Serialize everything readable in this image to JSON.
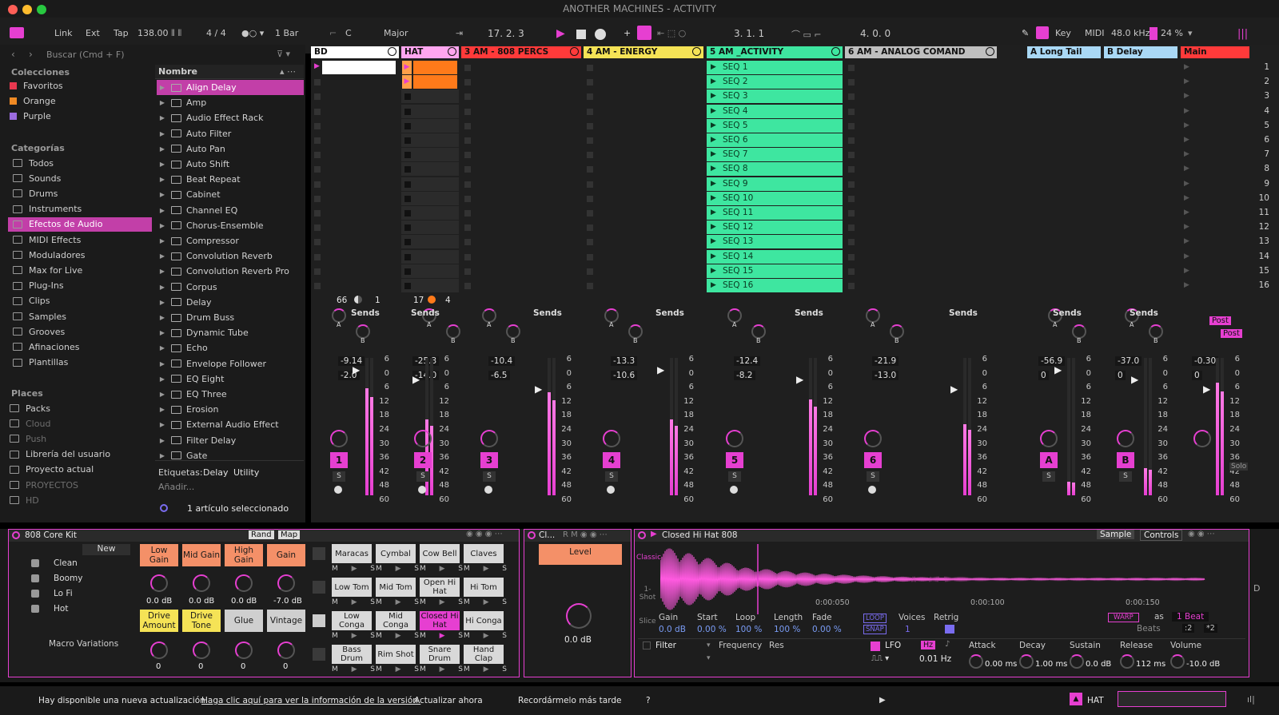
{
  "window": {
    "title": "ANOTHER MACHINES - ACTIVITY"
  },
  "control_bar": {
    "link": "Link",
    "ext": "Ext",
    "tap": "Tap",
    "tempo": "138.00",
    "signature": "4 / 4",
    "quantize": "1 Bar",
    "key_root": "C",
    "key_scale": "Major",
    "position": "17.   2.   3",
    "loop_start": "3.   1.   1",
    "loop_length": "4.   0.   0",
    "key_label": "Key",
    "midi_label": "MIDI",
    "sample_rate": "48.0 kHz",
    "cpu": "24 %"
  },
  "browser": {
    "search_placeholder": "Buscar (Cmd + F)",
    "name_header": "Nombre",
    "collections_title": "Colecciones",
    "collections": [
      {
        "label": "Favoritos",
        "color": "#e8384f"
      },
      {
        "label": "Orange",
        "color": "#f08a24"
      },
      {
        "label": "Purple",
        "color": "#9b6bdf"
      }
    ],
    "categories_title": "Categorías",
    "categories": [
      "Todos",
      "Sounds",
      "Drums",
      "Instruments",
      "Efectos de Audio",
      "MIDI Effects",
      "Moduladores",
      "Max for Live",
      "Plug-Ins",
      "Clips",
      "Samples",
      "Grooves",
      "Afinaciones",
      "Plantillas"
    ],
    "places_title": "Places",
    "places": [
      "Packs",
      "Cloud",
      "Push",
      "Librería del usuario",
      "Proyecto actual",
      "PROYECTOS",
      "HD"
    ],
    "items": [
      "Align Delay",
      "Amp",
      "Audio Effect Rack",
      "Auto Filter",
      "Auto Pan",
      "Auto Shift",
      "Beat Repeat",
      "Cabinet",
      "Channel EQ",
      "Chorus-Ensemble",
      "Compressor",
      "Convolution Reverb",
      "Convolution Reverb Pro",
      "Corpus",
      "Delay",
      "Drum Buss",
      "Dynamic Tube",
      "Echo",
      "Envelope Follower",
      "EQ Eight",
      "EQ Three",
      "Erosion",
      "External Audio Effect",
      "Filter Delay",
      "Gate"
    ],
    "tags_label": "Etiquetas:",
    "tags": [
      "Delay",
      "Utility"
    ],
    "add_label": "Añadir...",
    "selection_status": "1 artículo seleccionado"
  },
  "tracks": [
    {
      "name": "BD",
      "color": "#ffffff",
      "vol": "-9.14",
      "pan": "-2.0",
      "num": "1",
      "meter": 0.78
    },
    {
      "name": "HAT",
      "color": "#ffa6f0",
      "vol": "-25.3",
      "pan": "-14.0",
      "num": "2",
      "meter": 0.55
    },
    {
      "name": "3 AM - 808 PERCS",
      "color": "#ff3a3a",
      "vol": "-10.4",
      "pan": "-6.5",
      "num": "3",
      "meter": 0.75
    },
    {
      "name": "4 AM - ENERGY",
      "color": "#f5e356",
      "vol": "-13.3",
      "pan": "-10.6",
      "num": "4",
      "meter": 0.55
    },
    {
      "name": "5 AM _ACTIVITY",
      "color": "#3ee6a0",
      "vol": "-12.4",
      "pan": "-8.2",
      "num": "5",
      "meter": 0.7
    },
    {
      "name": "6 AM - ANALOG COMAND",
      "color": "#bfbfbf",
      "vol": "-21.9",
      "pan": "-13.0",
      "num": "6",
      "meter": 0.52
    },
    {
      "name": "A Long Tail",
      "color": "#a9d8f5",
      "vol": "-56.9",
      "pan": "0",
      "num": "A",
      "meter": 0.1
    },
    {
      "name": "B Delay",
      "color": "#a9d8f5",
      "vol": "-37.0",
      "pan": "0",
      "num": "B",
      "meter": 0.2
    },
    {
      "name": "Main",
      "color": "#ff3a3a",
      "vol": "-0.30",
      "pan": "0",
      "num": "",
      "meter": 0.82
    }
  ],
  "session": {
    "seq_clips": [
      "SEQ 1",
      "SEQ 2",
      "SEQ 3",
      "SEQ 4",
      "SEQ 5",
      "SEQ 6",
      "SEQ 7",
      "SEQ 8",
      "SEQ 9",
      "SEQ 10",
      "SEQ 11",
      "SEQ 12",
      "SEQ 13",
      "SEQ 14",
      "SEQ 15",
      "SEQ 16"
    ],
    "scenes": [
      "1",
      "2",
      "3",
      "4",
      "5",
      "6",
      "7",
      "8",
      "9",
      "10",
      "11",
      "12",
      "13",
      "14",
      "15",
      "16"
    ],
    "bd_io": {
      "a": "66",
      "b": "1"
    },
    "hat_io": {
      "a": "17",
      "b": "4"
    },
    "sends_label": "Sends",
    "db_scale": [
      "6",
      "0",
      "6",
      "12",
      "18",
      "24",
      "30",
      "36",
      "42",
      "48",
      "60"
    ],
    "post_label": "Post",
    "solo_label": "Solo"
  },
  "drum_rack": {
    "title": "808 Core Kit",
    "rand": "Rand",
    "map": "Map",
    "new": "New",
    "variations": [
      "Clean",
      "Boomy",
      "Lo Fi",
      "Hot"
    ],
    "macro_variations": "Macro Variations",
    "macros_top": [
      {
        "label": "Low Gain",
        "value": "0.0 dB"
      },
      {
        "label": "Mid Gain",
        "value": "0.0 dB"
      },
      {
        "label": "High Gain",
        "value": "0.0 dB"
      },
      {
        "label": "Gain",
        "value": "-7.0 dB"
      }
    ],
    "macros_bottom": [
      {
        "label": "Drive Amount",
        "value": "0"
      },
      {
        "label": "Drive Tone",
        "value": "0"
      },
      {
        "label": "Glue",
        "value": "0"
      },
      {
        "label": "Vintage",
        "value": "0"
      }
    ],
    "pads": [
      [
        "Maracas",
        "Cymbal",
        "Cow Bell",
        "Claves"
      ],
      [
        "Low Tom",
        "Mid Tom",
        "Open Hi Hat",
        "Hi Tom"
      ],
      [
        "Low Conga",
        "Mid Conga",
        "Closed Hi Hat",
        "Hi Conga"
      ],
      [
        "Bass Drum",
        "Rim Shot",
        "Snare Drum",
        "Hand Clap"
      ]
    ]
  },
  "chain": {
    "title": "Cl...",
    "level_label": "Level",
    "level_value": "0.0 dB"
  },
  "simpler": {
    "title": "Closed Hi Hat 808",
    "tab_sample": "Sample",
    "tab_controls": "Controls",
    "modes": [
      "Classic",
      "1-Shot",
      "Slice"
    ],
    "time_marks": [
      "0:00:050",
      "0:00:100",
      "0:00:150"
    ],
    "params": [
      {
        "label": "Gain",
        "value": "0.0 dB"
      },
      {
        "label": "Start",
        "value": "0.00 %"
      },
      {
        "label": "Loop",
        "value": "100 %"
      },
      {
        "label": "Length",
        "value": "100 %"
      },
      {
        "label": "Fade",
        "value": "0.00 %"
      }
    ],
    "loop": "LOOP",
    "snap": "SNAP",
    "voices_label": "Voices",
    "voices": "1",
    "retrig": "Retrig",
    "warp": "WARP",
    "as": "as",
    "beat": "1 Beat",
    "beats": "Beats",
    "div2": ":2",
    "mul2": "*2",
    "filter": "Filter",
    "frequency": "Frequency",
    "res": "Res",
    "lfo": "LFO",
    "hz": "Hz",
    "lfo_rate": "0.01 Hz",
    "env": [
      {
        "label": "Attack",
        "value": "0.00 ms"
      },
      {
        "label": "Decay",
        "value": "1.00 ms"
      },
      {
        "label": "Sustain",
        "value": "0.0 dB"
      },
      {
        "label": "Release",
        "value": "112 ms"
      },
      {
        "label": "Volume",
        "value": "-10.0 dB"
      }
    ]
  },
  "status_bar": {
    "message": "Hay disponible una nueva actualización.",
    "link": "Haga clic aquí para ver la información de la versión.",
    "update_now": "Actualizar ahora",
    "remind_later": "Recordármelo más tarde",
    "help": "?",
    "track_name": "HAT"
  },
  "colors": {
    "accent": "#e63fd1",
    "seq": "#3ee6a0",
    "orange": "#ff7a1a"
  }
}
